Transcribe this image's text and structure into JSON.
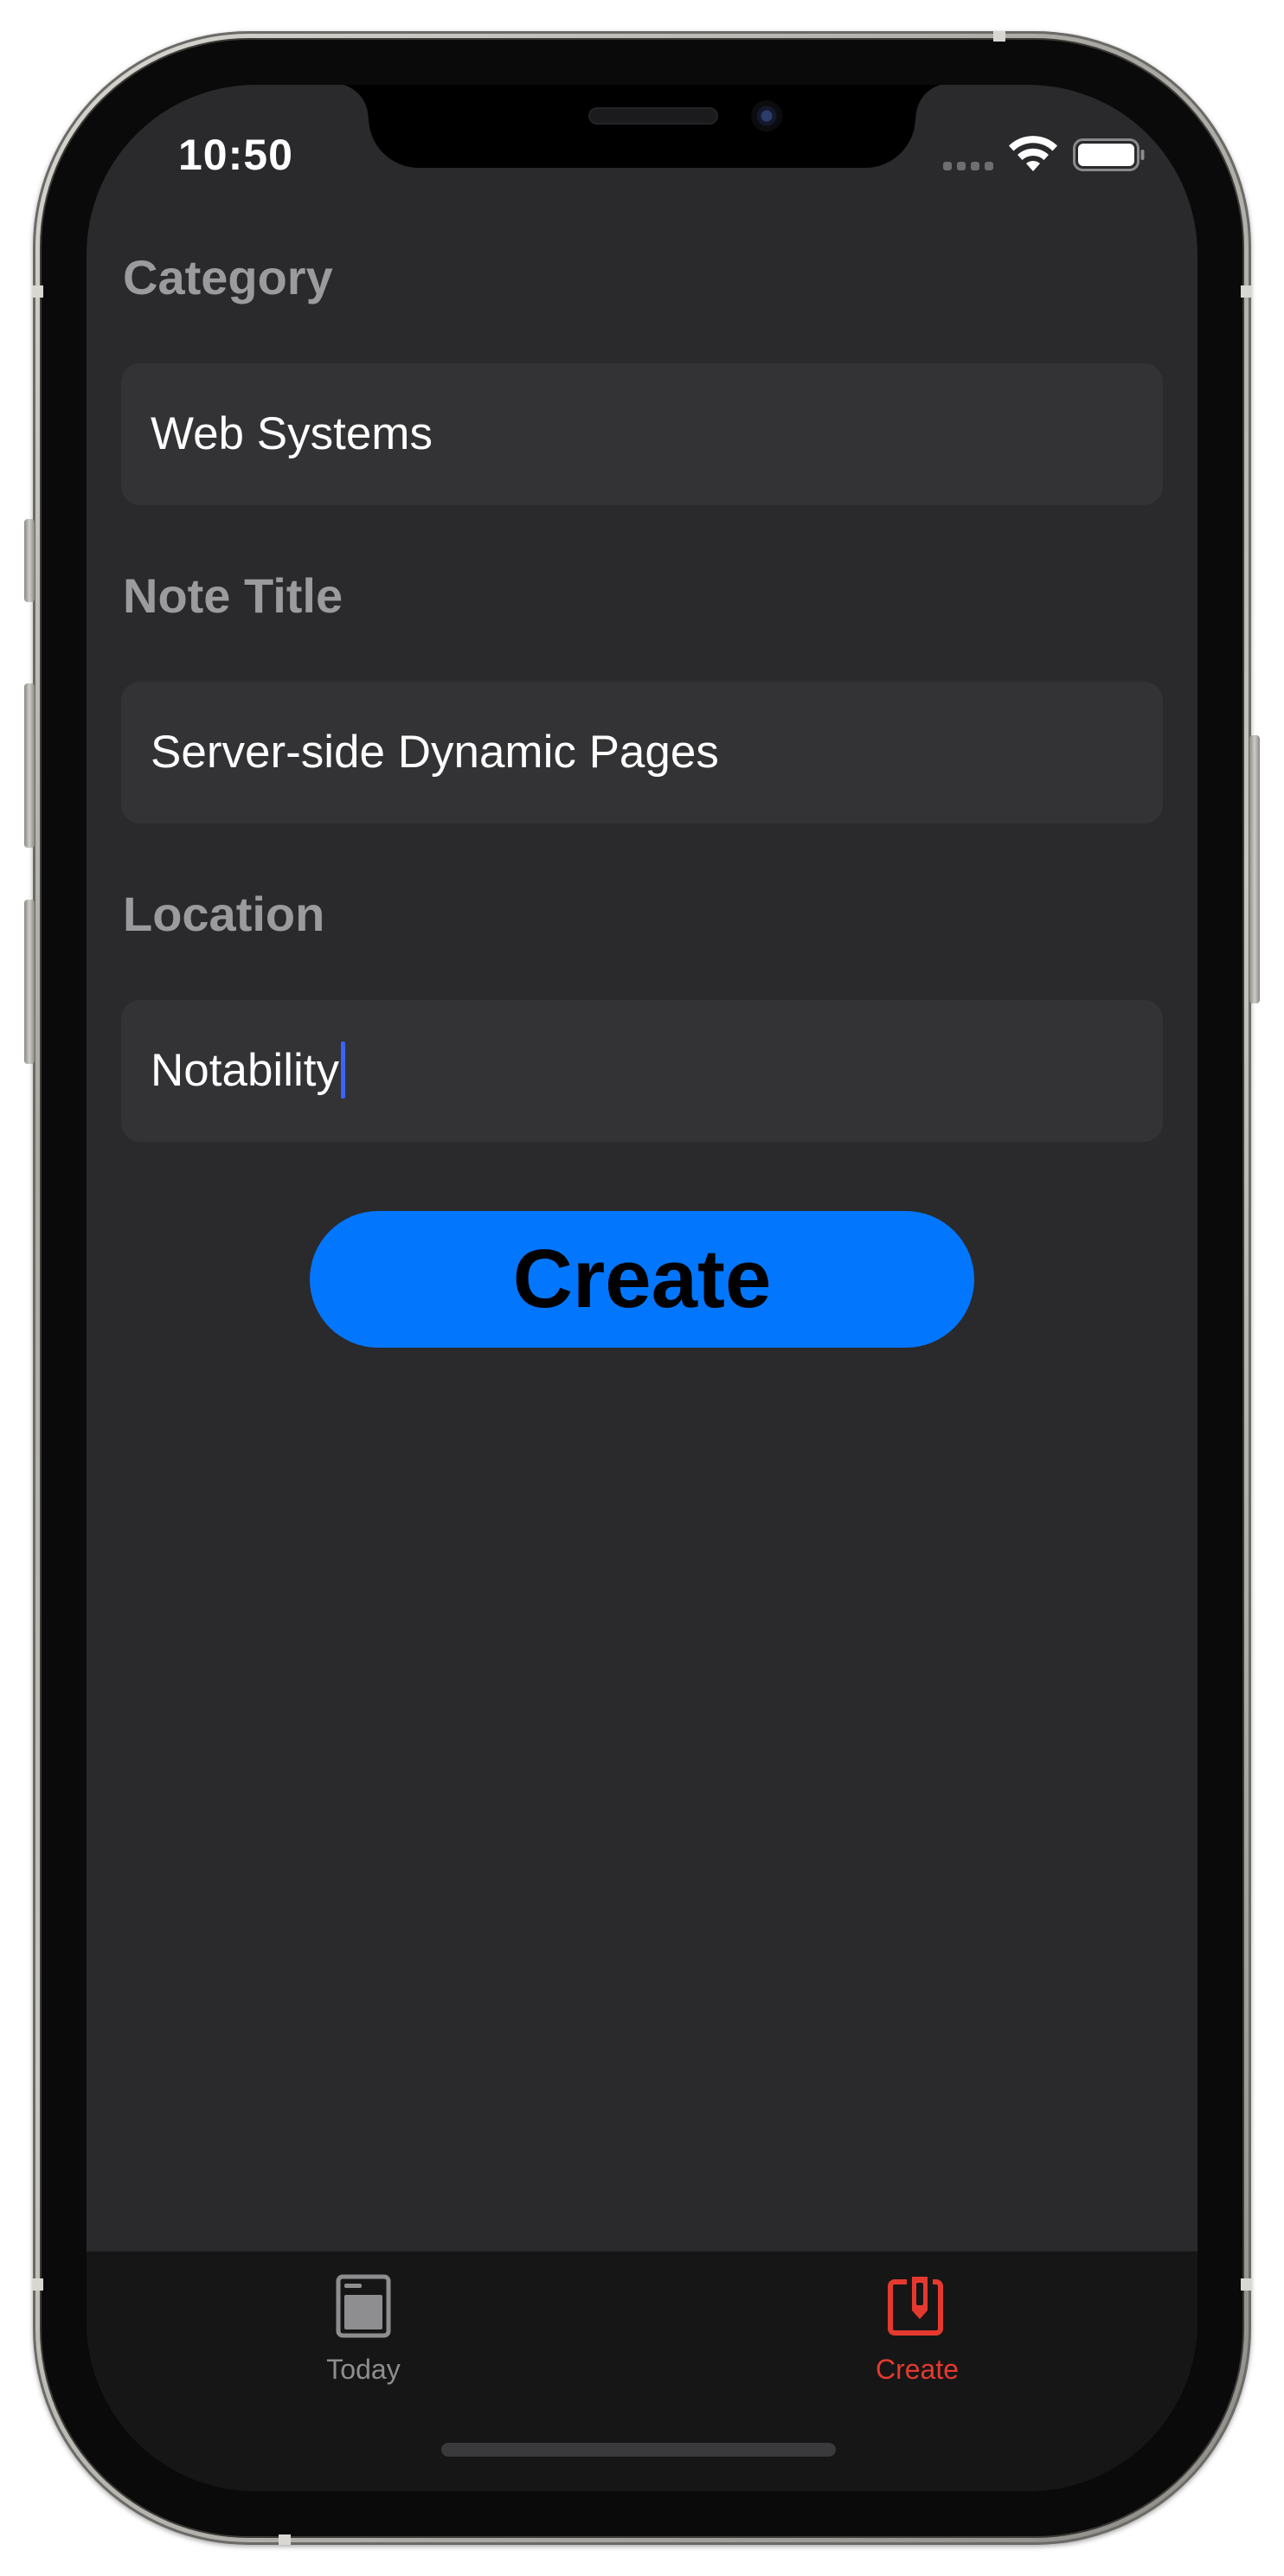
{
  "status_bar": {
    "time": "10:50"
  },
  "form": {
    "category": {
      "label": "Category",
      "value": "Web Systems"
    },
    "note_title": {
      "label": "Note Title",
      "value": "Server-side Dynamic Pages"
    },
    "location": {
      "label": "Location",
      "value": "Notability"
    },
    "create_label": "Create"
  },
  "tab_bar": {
    "tabs": [
      {
        "label": "Today",
        "icon": "book-icon",
        "selected": false
      },
      {
        "label": "Create",
        "icon": "square-and-pencil-icon",
        "selected": true
      }
    ]
  },
  "colors": {
    "screen_background": "#2a292b",
    "field_background": "#333234",
    "label_gray": "#9b9b9d",
    "accent_blue": "#0277fe",
    "tab_selected_red": "#e5392f",
    "tab_unselected_gray": "#8e8e90",
    "caret_blue": "#3b63ff",
    "tab_bar_background": "#161616"
  }
}
